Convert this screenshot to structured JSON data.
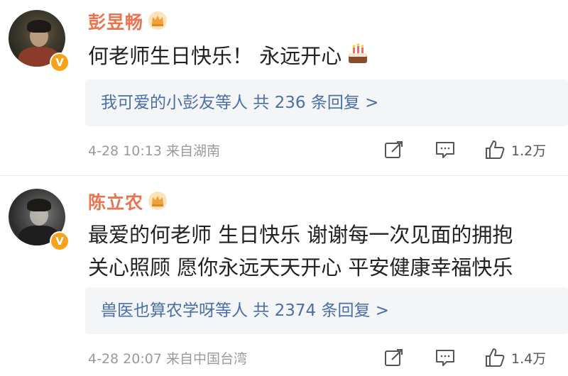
{
  "comments": [
    {
      "username": "彭昱畅",
      "verified_badge": "V",
      "crown_icon": "crown-icon",
      "text": "何老师生日快乐！ 永远开心",
      "emoji": "cake-icon",
      "reply_summary": "我可爱的小彭友等人  共 236 条回复 >",
      "date": "4-28 10:13",
      "location": "来自湖南",
      "likes": "1.2万"
    },
    {
      "username": "陈立农",
      "verified_badge": "V",
      "crown_icon": "crown-icon",
      "text": "最爱的何老师 生日快乐 谢谢每一次见面的拥抱\n关心照顾 愿你永远天天开心 平安健康幸福快乐",
      "emoji": "",
      "reply_summary": "兽医也算农学呀等人  共 2374 条回复 >",
      "date": "4-28 20:07",
      "location": "来自中国台湾",
      "likes": "1.4万"
    }
  ],
  "colors": {
    "username": "#eb7350",
    "reply_link": "#4a6ea9",
    "meta": "#9a9a9a",
    "badge": "#f7a21b"
  }
}
